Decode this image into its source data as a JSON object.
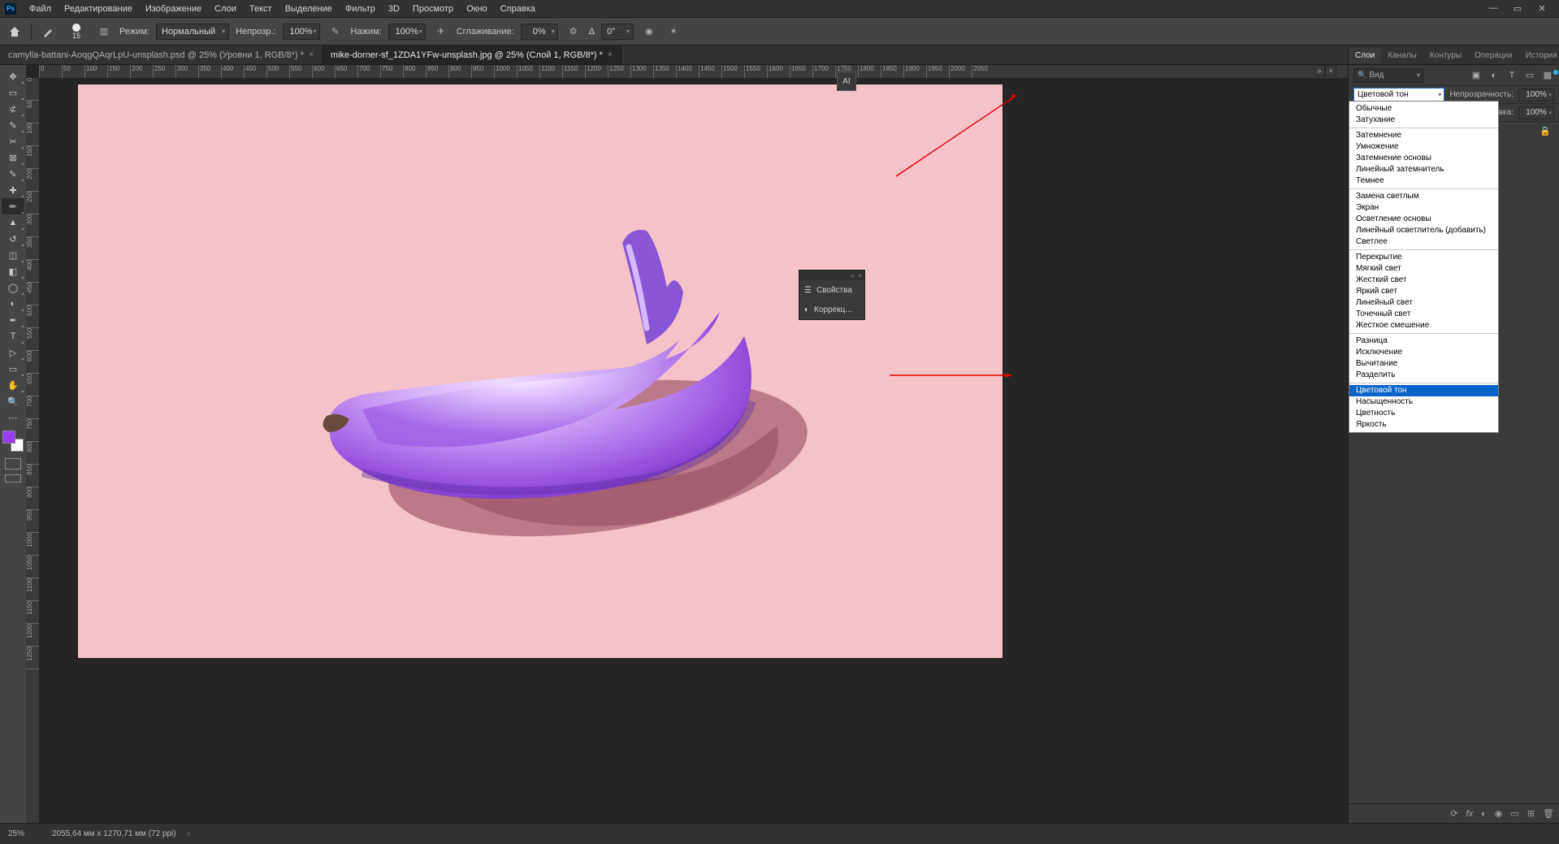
{
  "menubar": {
    "items": [
      "Файл",
      "Редактирование",
      "Изображение",
      "Слои",
      "Текст",
      "Выделение",
      "Фильтр",
      "3D",
      "Просмотр",
      "Окно",
      "Справка"
    ]
  },
  "optbar": {
    "brush_size": "15",
    "mode_label": "Режим:",
    "mode_value": "Нормальный",
    "opacity_label": "Непрозр.:",
    "opacity_value": "100%",
    "flow_label": "Нажим:",
    "flow_value": "100%",
    "smooth_label": "Сглаживание:",
    "smooth_value": "0%",
    "angle_label": "Δ",
    "angle_value": "0°"
  },
  "tabs": [
    {
      "title": "camylla-battani-AoqgQAqrLpU-unsplash.psd @ 25% (Уровни 1, RGB/8*) *"
    },
    {
      "title": "mike-dorner-sf_1ZDA1YFw-unsplash.jpg @ 25% (Слой 1, RGB/8*) *"
    }
  ],
  "ruler_ticks": [
    "0",
    "50",
    "100",
    "150",
    "200",
    "250",
    "300",
    "350",
    "400",
    "450",
    "500",
    "550",
    "600",
    "650",
    "700",
    "750",
    "800",
    "850",
    "900",
    "950",
    "1000",
    "1050",
    "1100",
    "1150",
    "1200",
    "1250",
    "1300",
    "1350",
    "1400",
    "1450",
    "1500",
    "1550",
    "1600",
    "1650",
    "1700",
    "1750",
    "1800",
    "1850",
    "1900",
    "1950",
    "2000",
    "2050"
  ],
  "ruler_ticks_v": [
    "0",
    "50",
    "100",
    "150",
    "200",
    "250",
    "300",
    "350",
    "400",
    "450",
    "500",
    "550",
    "600",
    "650",
    "700",
    "750",
    "800",
    "850",
    "900",
    "950",
    "1000",
    "1050",
    "1100",
    "1150",
    "1200",
    "1250"
  ],
  "ai_btn": "AI",
  "float_panel": {
    "props": "Свойства",
    "correct": "Коррекц..."
  },
  "layers": {
    "tabs": [
      "Слои",
      "Каналы",
      "Контуры",
      "Операции",
      "История"
    ],
    "search_placeholder": "Вид",
    "blend_value": "Цветовой тон",
    "opacity_label": "Непрозрачность:",
    "opacity_value": "100%",
    "fill_label": "Заливка:",
    "fill_value": "100%"
  },
  "blend_modes": [
    [
      "Обычные",
      "Затухание"
    ],
    [
      "Затемнение",
      "Умножение",
      "Затемнение основы",
      "Линейный затемнитель",
      "Темнее"
    ],
    [
      "Замена светлым",
      "Экран",
      "Осветление основы",
      "Линейный осветлитель (добавить)",
      "Светлее"
    ],
    [
      "Перекрытие",
      "Мягкий свет",
      "Жесткий свет",
      "Яркий свет",
      "Линейный свет",
      "Точечный свет",
      "Жесткое смешение"
    ],
    [
      "Разница",
      "Исключение",
      "Вычитание",
      "Разделить"
    ],
    [
      "Цветовой тон",
      "Насыщенность",
      "Цветность",
      "Яркость"
    ]
  ],
  "blend_selected": "Цветовой тон",
  "status": {
    "zoom": "25%",
    "docinfo": "2055,64 мм x 1270,71 мм (72 ppi)"
  },
  "colors": {
    "canvas_bg": "#f4c2c9",
    "banana_hi": "#e0c3ff",
    "banana_mid": "#b77df0",
    "banana_lo": "#7a34c6",
    "shadow": "#b55f72"
  },
  "tool_icons": [
    "↔",
    "▭",
    "⊄",
    "✎",
    "✂",
    "▢",
    "⬚",
    "✎",
    "✏",
    "⟋",
    "✶",
    "◌",
    "⌫",
    "⬯",
    "△",
    "◐",
    "✎",
    "T",
    "◺",
    "✋",
    "⊕",
    "⋯"
  ],
  "bottom_icons": [
    "⟳",
    "fx",
    "◐",
    "◉",
    "▭",
    "⊞",
    "🗑"
  ]
}
